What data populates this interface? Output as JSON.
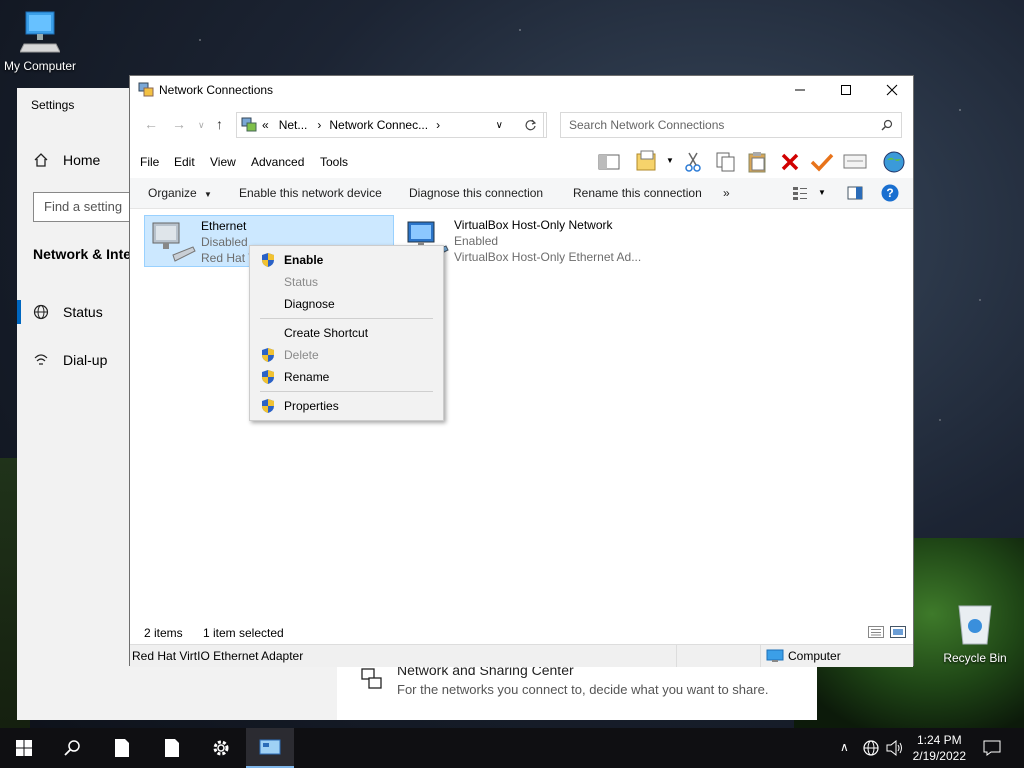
{
  "desktop": {
    "my_computer_label": "My Computer",
    "recycle_bin_label": "Recycle Bin"
  },
  "settings": {
    "title": "Settings",
    "home": "Home",
    "search_placeholder": "Find a setting",
    "heading": "Network & Internet",
    "items": [
      {
        "label": "Status",
        "icon": "globe-icon"
      },
      {
        "label": "Dial-up",
        "icon": "dialup-icon"
      }
    ],
    "nsc_title": "Network and Sharing Center",
    "nsc_desc": "For the networks you connect to, decide what you want to share."
  },
  "explorer": {
    "title": "Network Connections",
    "address_parts": [
      "«",
      "Net...",
      "›",
      "Network Connec...",
      "›"
    ],
    "search_placeholder": "Search Network Connections",
    "menu": [
      "File",
      "Edit",
      "View",
      "Advanced",
      "Tools"
    ],
    "commands": [
      "Organize",
      "Enable this network device",
      "Diagnose this connection",
      "Rename this connection",
      "»"
    ],
    "items": [
      {
        "name": "Ethernet",
        "status": "Disabled",
        "device": "Red Hat VirtIO Ethernet Adapter",
        "selected": true
      },
      {
        "name": "VirtualBox Host-Only Network",
        "status": "Enabled",
        "device": "VirtualBox Host-Only Ethernet Ad...",
        "selected": false
      }
    ],
    "status_items": "2 items",
    "status_selected": "1 item selected",
    "details_device": "Red Hat VirtIO Ethernet Adapter",
    "details_location": "Computer"
  },
  "context_menu": {
    "items": [
      {
        "label": "Enable",
        "shield": true,
        "bold": true,
        "disabled": false
      },
      {
        "label": "Status",
        "shield": false,
        "bold": false,
        "disabled": true
      },
      {
        "label": "Diagnose",
        "shield": false,
        "bold": false,
        "disabled": false
      },
      {
        "label": "Create Shortcut",
        "shield": false,
        "bold": false,
        "disabled": false
      },
      {
        "label": "Delete",
        "shield": true,
        "bold": false,
        "disabled": true
      },
      {
        "label": "Rename",
        "shield": true,
        "bold": false,
        "disabled": false
      },
      {
        "label": "Properties",
        "shield": true,
        "bold": false,
        "disabled": false
      }
    ]
  },
  "taskbar": {
    "time": "1:24 PM",
    "date": "2/19/2022"
  },
  "colors": {
    "accent": "#0067c0",
    "selection": "#cce8ff",
    "delete_red": "#d10000",
    "check_orange": "#e8731a"
  }
}
